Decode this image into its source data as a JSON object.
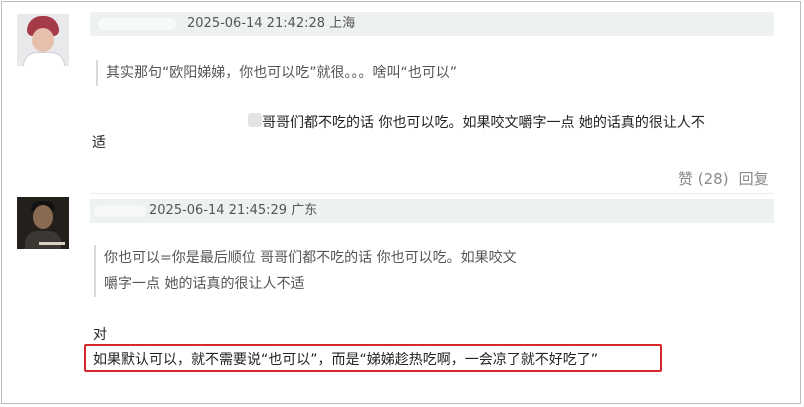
{
  "comments": [
    {
      "username": "",
      "timestamp": "2025-06-14 21:42:28",
      "location": "上海",
      "quote": "其实那句“欧阳娣娣，你也可以吃”就很。。。啥叫“也可以”",
      "reply_line1": "哥哥们都不吃的话 你也可以吃。如果咬文嚼字一点 她的话真的很让人不",
      "reply_line2": "适",
      "like_label": "赞 (28)",
      "reply_label": "回复"
    },
    {
      "username": "",
      "timestamp": "2025-06-14 21:45:29",
      "location": "广东",
      "quote_line1": "你也可以=你是最后顺位 哥哥们都不吃的话 你也可以吃。如果咬文",
      "quote_line2": "嚼字一点 她的话真的很让人不适",
      "reply_line1": "对",
      "reply_line2": "如果默认可以，就不需要说“也可以”，而是“娣娣趁热吃啊，一会凉了就不好吃了”"
    }
  ],
  "colors": {
    "highlight_border": "#d6282b",
    "header_bg": "#eef2ef"
  }
}
